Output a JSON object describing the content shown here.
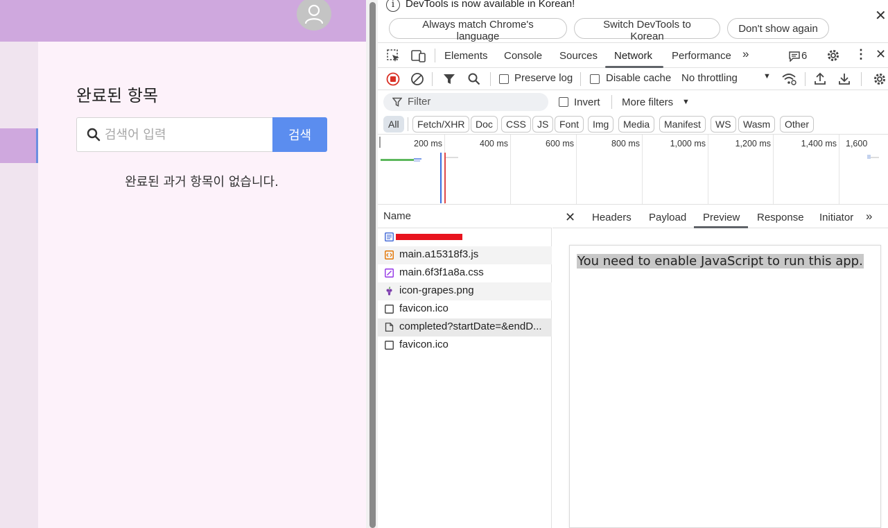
{
  "app": {
    "title": "완료된 항목",
    "search_placeholder": "검색어 입력",
    "search_button": "검색",
    "empty_message": "완료된 과거 항목이 없습니다."
  },
  "devtools": {
    "info_bar": {
      "message": "DevTools is now available in Korean!",
      "btn_always": "Always match Chrome's language",
      "btn_switch": "Switch DevTools to Korean",
      "btn_dont_show": "Don't show again"
    },
    "tabs": [
      "Elements",
      "Console",
      "Sources",
      "Network",
      "Performance"
    ],
    "active_tab": "Network",
    "issues_count": "6",
    "toolbar": {
      "preserve_log": "Preserve log",
      "disable_cache": "Disable cache",
      "throttling": "No throttling"
    },
    "filter": {
      "placeholder": "Filter",
      "invert": "Invert",
      "more_filters": "More filters"
    },
    "type_filters": [
      "All",
      "Fetch/XHR",
      "Doc",
      "CSS",
      "JS",
      "Font",
      "Img",
      "Media",
      "Manifest",
      "WS",
      "Wasm",
      "Other"
    ],
    "timeline_ticks": [
      "200 ms",
      "400 ms",
      "600 ms",
      "800 ms",
      "1,000 ms",
      "1,200 ms",
      "1,400 ms",
      "1,600"
    ],
    "name_header": "Name",
    "requests": [
      {
        "name": "",
        "icon": "document-icon"
      },
      {
        "name": "main.a15318f3.js",
        "icon": "script-icon"
      },
      {
        "name": "main.6f3f1a8a.css",
        "icon": "stylesheet-icon"
      },
      {
        "name": "icon-grapes.png",
        "icon": "image-icon"
      },
      {
        "name": "favicon.ico",
        "icon": "file-icon"
      },
      {
        "name": "completed?startDate=&endD...",
        "icon": "page-icon"
      },
      {
        "name": "favicon.ico",
        "icon": "file-icon"
      }
    ],
    "detail_tabs": [
      "Headers",
      "Payload",
      "Preview",
      "Response",
      "Initiator"
    ],
    "active_detail_tab": "Preview",
    "preview_text": "You need to enable JavaScript to run this app."
  },
  "colors": {
    "app_header": "#cfa8de",
    "app_bg": "#fdf2fa",
    "search_button": "#5b8def",
    "record_red": "#d93025"
  }
}
